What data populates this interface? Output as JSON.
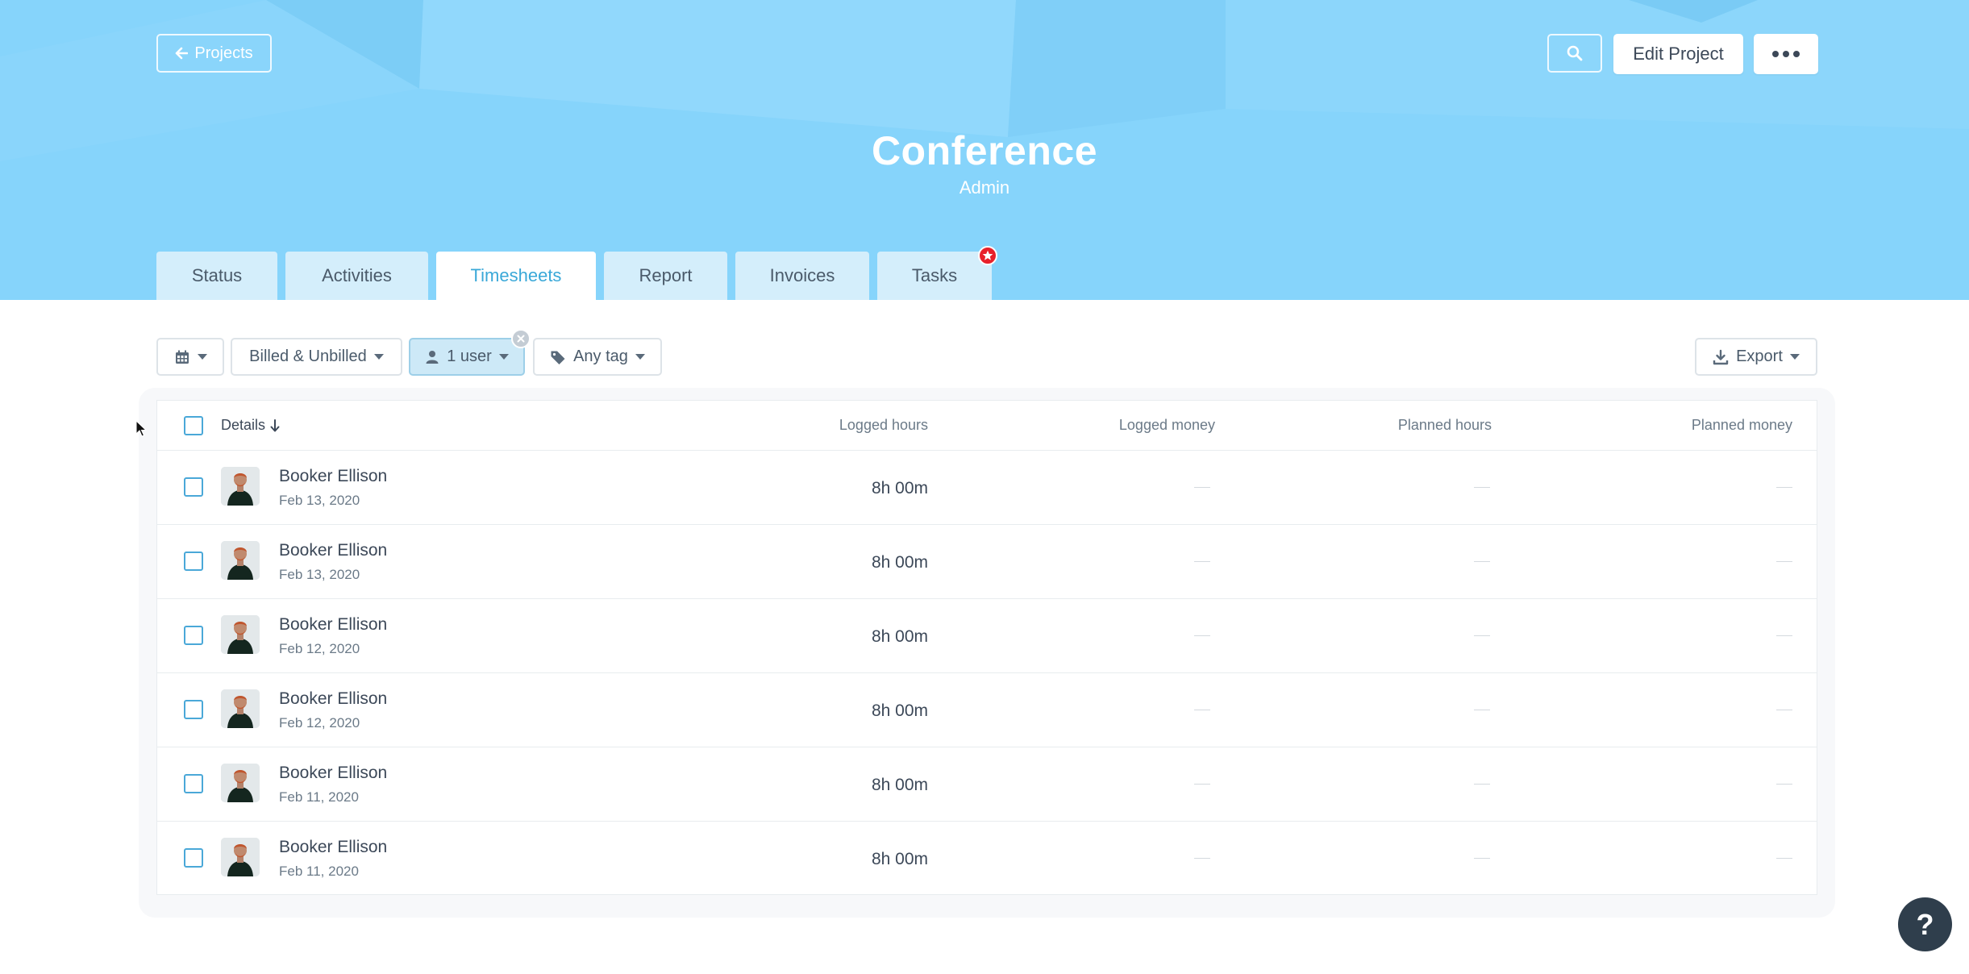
{
  "header": {
    "back_label": "Projects",
    "project_title": "Conference",
    "project_subtitle": "Admin",
    "edit_label": "Edit Project"
  },
  "tabs": [
    {
      "label": "Status",
      "active": false
    },
    {
      "label": "Activities",
      "active": false
    },
    {
      "label": "Timesheets",
      "active": true
    },
    {
      "label": "Report",
      "active": false
    },
    {
      "label": "Invoices",
      "active": false
    },
    {
      "label": "Tasks",
      "active": false
    }
  ],
  "filters": {
    "billing": "Billed & Unbilled",
    "user": "1 user",
    "tag": "Any tag",
    "export": "Export"
  },
  "table": {
    "columns": {
      "details": "Details",
      "logged_hours": "Logged hours",
      "logged_money": "Logged money",
      "planned_hours": "Planned hours",
      "planned_money": "Planned money"
    },
    "rows": [
      {
        "name": "Booker Ellison",
        "date": "Feb 13, 2020",
        "hours": "8h  00m"
      },
      {
        "name": "Booker Ellison",
        "date": "Feb 13, 2020",
        "hours": "8h  00m"
      },
      {
        "name": "Booker Ellison",
        "date": "Feb 12, 2020",
        "hours": "8h  00m"
      },
      {
        "name": "Booker Ellison",
        "date": "Feb 12, 2020",
        "hours": "8h  00m"
      },
      {
        "name": "Booker Ellison",
        "date": "Feb 11, 2020",
        "hours": "8h  00m"
      },
      {
        "name": "Booker Ellison",
        "date": "Feb 11, 2020",
        "hours": "8h  00m"
      }
    ]
  },
  "help": {
    "label": "?"
  },
  "colors": {
    "header_bg": "#86d4fb",
    "accent": "#3aa8d8",
    "badge_red": "#e8202a",
    "help_bg": "#2f3e4c"
  },
  "icons": {
    "back": "arrow-left-icon",
    "search": "search-icon",
    "more": "ellipsis-icon",
    "calendar": "calendar-icon",
    "user": "user-icon",
    "tag": "tag-icon",
    "export": "download-icon",
    "sort": "arrow-down-icon",
    "badge": "star-icon"
  }
}
